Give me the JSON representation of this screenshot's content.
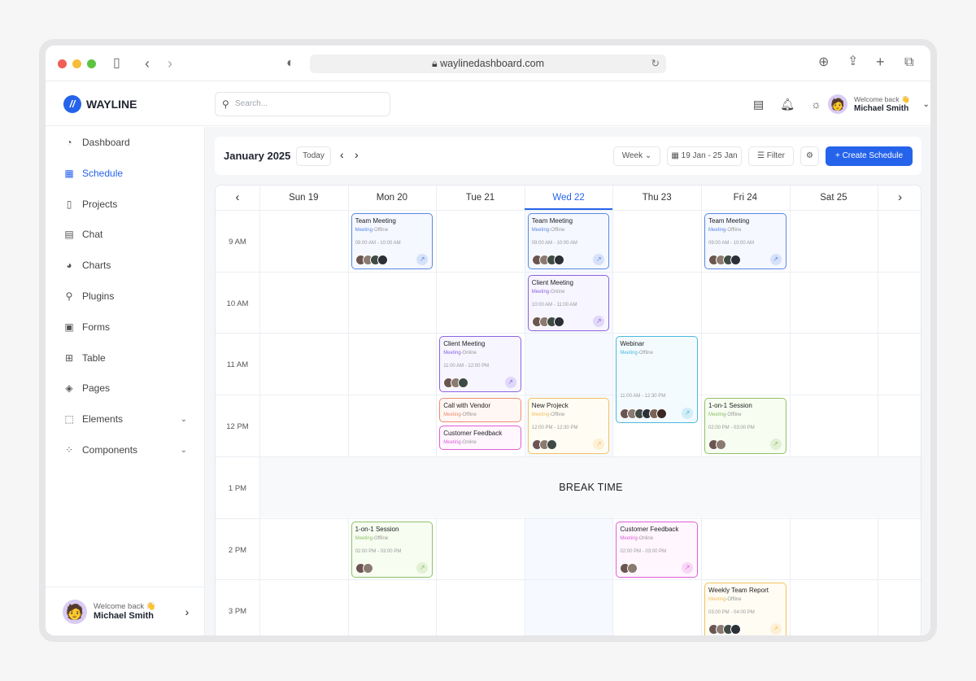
{
  "browser": {
    "url": "waylinedashboard.com"
  },
  "app": {
    "brand": "WAYLINE",
    "search_placeholder": "Search...",
    "welcome": "Welcome back 👋",
    "user_name": "Michael Smith"
  },
  "sidebar": {
    "items": [
      {
        "label": "Dashboard",
        "icon": "gauge-icon",
        "glyph": "◔"
      },
      {
        "label": "Schedule",
        "icon": "calendar-icon",
        "glyph": "▦",
        "active": true
      },
      {
        "label": "Projects",
        "icon": "file-icon",
        "glyph": "▯"
      },
      {
        "label": "Chat",
        "icon": "chat-icon",
        "glyph": "▤"
      },
      {
        "label": "Charts",
        "icon": "pie-chart-icon",
        "glyph": "◕"
      },
      {
        "label": "Plugins",
        "icon": "plug-icon",
        "glyph": "⚲"
      },
      {
        "label": "Forms",
        "icon": "clipboard-icon",
        "glyph": "▣"
      },
      {
        "label": "Table",
        "icon": "table-icon",
        "glyph": "⊞"
      },
      {
        "label": "Pages",
        "icon": "layers-icon",
        "glyph": "◈"
      },
      {
        "label": "Elements",
        "icon": "cursor-icon",
        "glyph": "⬚",
        "expandable": true
      },
      {
        "label": "Components",
        "icon": "components-icon",
        "glyph": "⁘",
        "expandable": true
      }
    ]
  },
  "toolbar": {
    "title": "January 2025",
    "today": "Today",
    "view": "Week",
    "range": "19 Jan - 25 Jan",
    "filter": "Filter",
    "create": "Create Schedule"
  },
  "calendar": {
    "days": [
      "Sun 19",
      "Mon 20",
      "Tue 21",
      "Wed 22",
      "Thu 23",
      "Fri 24",
      "Sat 25"
    ],
    "today": "Wed 22",
    "times": [
      "9 AM",
      "10 AM",
      "11 AM",
      "12 PM",
      "1 PM",
      "2 PM",
      "3 PM"
    ],
    "break_label": "BREAK TIME",
    "events": [
      {
        "title": "Team Meeting",
        "type": "Meeting",
        "mode": "-Offline",
        "time": "09:00 AM - 10:00 AM",
        "day": "Mon 20",
        "attendees": 4,
        "color": "#5b87e6",
        "bg": "#f5f8ff"
      },
      {
        "title": "Team Meeting",
        "type": "Meeting",
        "mode": "-Offline",
        "time": "09:00 AM - 10:00 AM",
        "day": "Wed 22",
        "attendees": 4,
        "color": "#5b87e6",
        "bg": "#f5f8ff"
      },
      {
        "title": "Team Meeting",
        "type": "Meeting",
        "mode": "-Offline",
        "time": "09:00 AM - 10:00 AM",
        "day": "Fri 24",
        "attendees": 4,
        "color": "#5b87e6",
        "bg": "#f5f8ff"
      },
      {
        "title": "Client Meeting",
        "type": "Meeting",
        "mode": "-Online",
        "time": "10:00 AM - 11:00 AM",
        "day": "Wed 22",
        "attendees": 4,
        "color": "#8b63e0",
        "bg": "#f7f5ff"
      },
      {
        "title": "Client Meeting",
        "type": "Meeting",
        "mode": "-Online",
        "time": "11:00 AM - 12:00 PM",
        "day": "Tue 21",
        "attendees": 3,
        "color": "#8b63e0",
        "bg": "#f7f5ff"
      },
      {
        "title": "Webinar",
        "type": "Meeting",
        "mode": "-Offline",
        "time": "11:00 AM - 12:30 PM",
        "day": "Thu 23",
        "attendees": 6,
        "color": "#4cb8dc",
        "bg": "#f3fbff"
      },
      {
        "title": "Call with Vendor",
        "type": "Meeting",
        "mode": "-Offline",
        "day": "Tue 21",
        "color": "#ef8a6a",
        "bg": "#fff7f4"
      },
      {
        "title": "Customer Feedback",
        "type": "Meeting",
        "mode": "-Online",
        "day": "Tue 21",
        "color": "#dd5fd6",
        "bg": "#fff6fe"
      },
      {
        "title": "New Projeck",
        "type": "Meeting",
        "mode": "-Offline",
        "time": "12:00 PM - 12:30 PM",
        "day": "Wed 22",
        "attendees": 3,
        "color": "#f0c260",
        "bg": "#fffcf3"
      },
      {
        "title": "1-on-1 Session",
        "type": "Meeting",
        "mode": "-Offline",
        "time": "02:00 PM - 03:00 PM",
        "day": "Fri 24",
        "attendees": 2,
        "color": "#8fc06b",
        "bg": "#f7fdf1"
      },
      {
        "title": "1-on-1 Session",
        "type": "Meeting",
        "mode": "-Offline",
        "time": "02:00 PM - 03:00 PM",
        "day": "Mon 20",
        "attendees": 2,
        "color": "#8fc06b",
        "bg": "#f7fdf1"
      },
      {
        "title": "Customer Feedback",
        "type": "Meeting",
        "mode": "-Online",
        "time": "02:00 PM - 03:00 PM",
        "day": "Thu 23",
        "attendees": 2,
        "color": "#dd5fd6",
        "bg": "#fff6fe"
      },
      {
        "title": "Weekly Team Report",
        "type": "Meeting",
        "mode": "-Offline",
        "time": "03:00 PM - 04:00 PM",
        "day": "Fri 24",
        "attendees": 4,
        "color": "#f0c260",
        "bg": "#fffcf3"
      }
    ]
  },
  "colors": {
    "accent": "#2563eb"
  }
}
